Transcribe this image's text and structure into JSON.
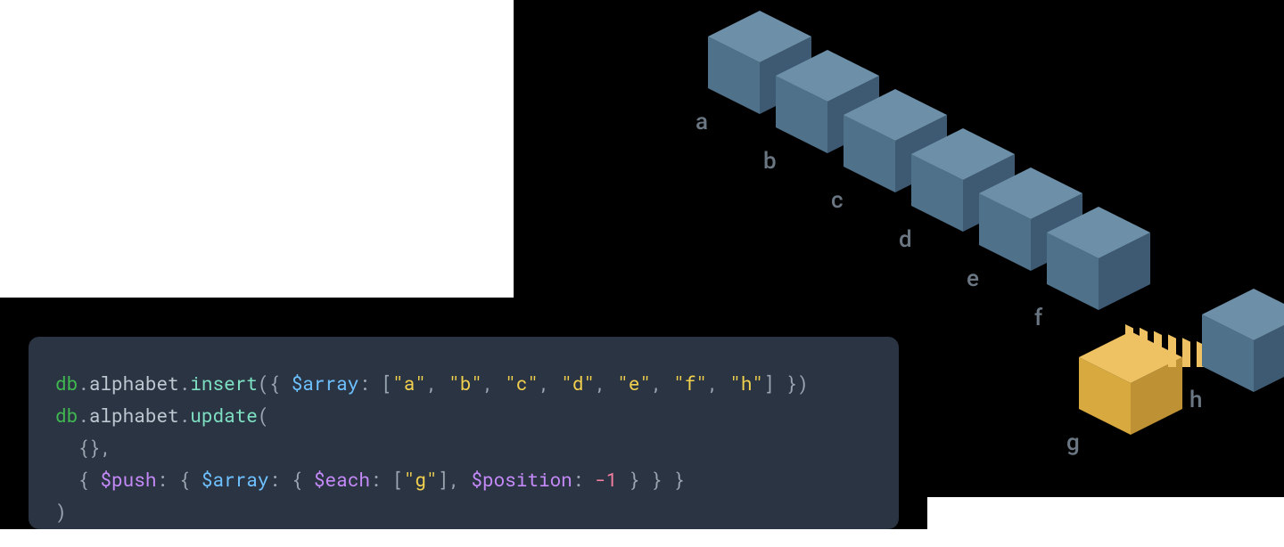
{
  "code": {
    "line1": {
      "db": "db",
      "dot1": ".",
      "coll": "alphabet",
      "dot2": ".",
      "fn": "insert",
      "open": "({ ",
      "key": "$array",
      "colon": ": [",
      "arr": [
        "\"a\"",
        "\"b\"",
        "\"c\"",
        "\"d\"",
        "\"e\"",
        "\"f\"",
        "\"h\""
      ],
      "close": "] })"
    },
    "line2": {
      "db": "db",
      "dot1": ".",
      "coll": "alphabet",
      "dot2": ".",
      "fn": "update",
      "open": "("
    },
    "line3": {
      "text": "  {},"
    },
    "line4": {
      "indent": "  { ",
      "push": "$push",
      "c1": ": { ",
      "array": "$array",
      "c2": ": { ",
      "each": "$each",
      "c3": ": [",
      "g": "\"g\"",
      "c4": "], ",
      "position": "$position",
      "c5": ": ",
      "num": "-1",
      "c6": " } } }"
    },
    "line5": {
      "text": ")"
    }
  },
  "cubes": {
    "blue": [
      "a",
      "b",
      "c",
      "d",
      "e",
      "f"
    ],
    "tail": "h",
    "insert": "g",
    "colors": {
      "blue_top": "#6d90a8",
      "blue_left": "#4f718a",
      "blue_right": "#3d5a72",
      "gold_top": "#eec263",
      "gold_left": "#d8a93e",
      "gold_right": "#be9234"
    }
  }
}
